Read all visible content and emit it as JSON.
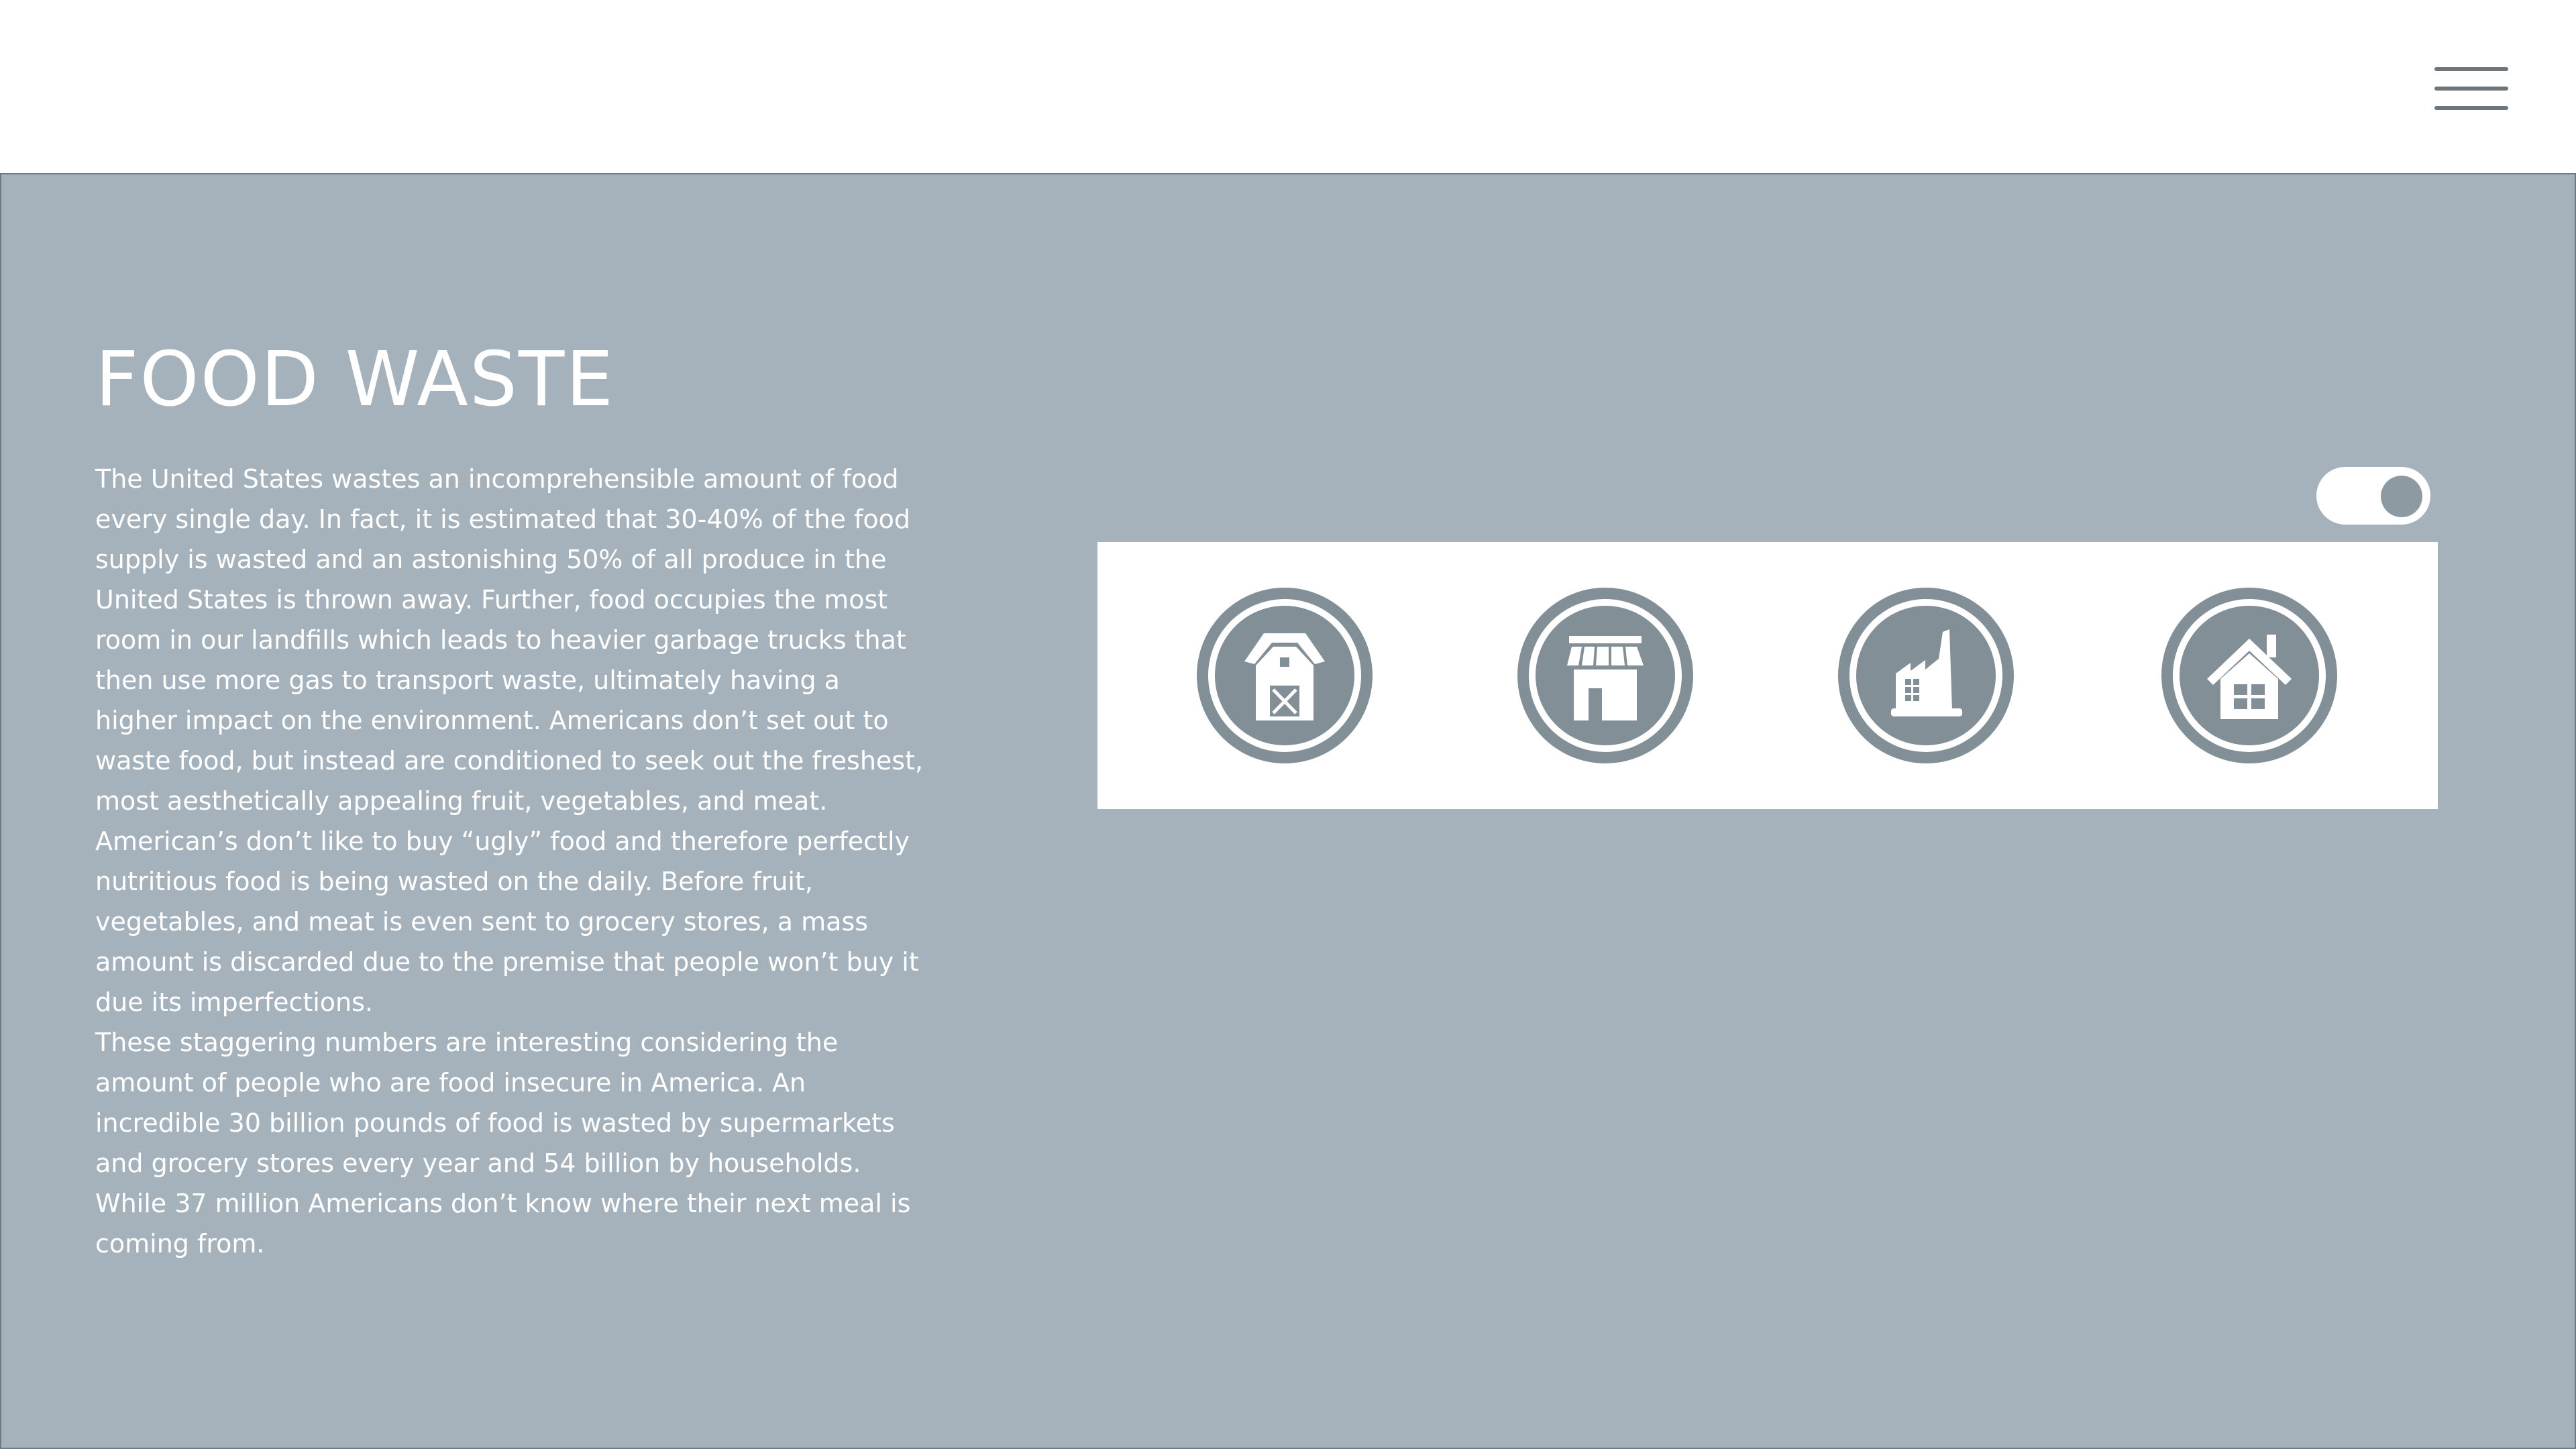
{
  "header": {
    "menu_icon": "hamburger-menu-icon"
  },
  "main": {
    "title": "FOOD WASTE",
    "paragraphs": [
      "The United States wastes an incomprehensible amount of food every single day. In fact, it is estimated that 30-40% of the food supply is wasted and an astonishing 50% of all produce in the United States is thrown away. Further, food occupies the most room in our landfills which leads to heavier garbage trucks that then use more gas to transport waste, ultimately having a higher impact on the environment. Americans don’t set out to waste food, but instead are conditioned to seek out the freshest, most aesthetically appealing fruit, vegetables, and meat. American’s don’t like to buy “ugly” food and therefore perfectly nutritious food is being wasted on the daily. Before fruit, vegetables, and meat is even sent to grocery stores, a mass amount  is discarded due to the premise that people won’t buy it due its imperfections.",
      "These staggering numbers are interesting considering the amount of people who are food insecure in America. An incredible 30 billion pounds of food is wasted by supermarkets and grocery stores every year and 54 billion by households. While 37 million Americans don’t know where their next meal is coming from."
    ]
  },
  "controls": {
    "toggle_on": true
  },
  "icons": [
    "barn-icon",
    "store-icon",
    "factory-icon",
    "house-icon"
  ],
  "colors": {
    "panel_background": "#a6b2bb",
    "icon_grey": "#838f97",
    "text": "#ffffff"
  }
}
